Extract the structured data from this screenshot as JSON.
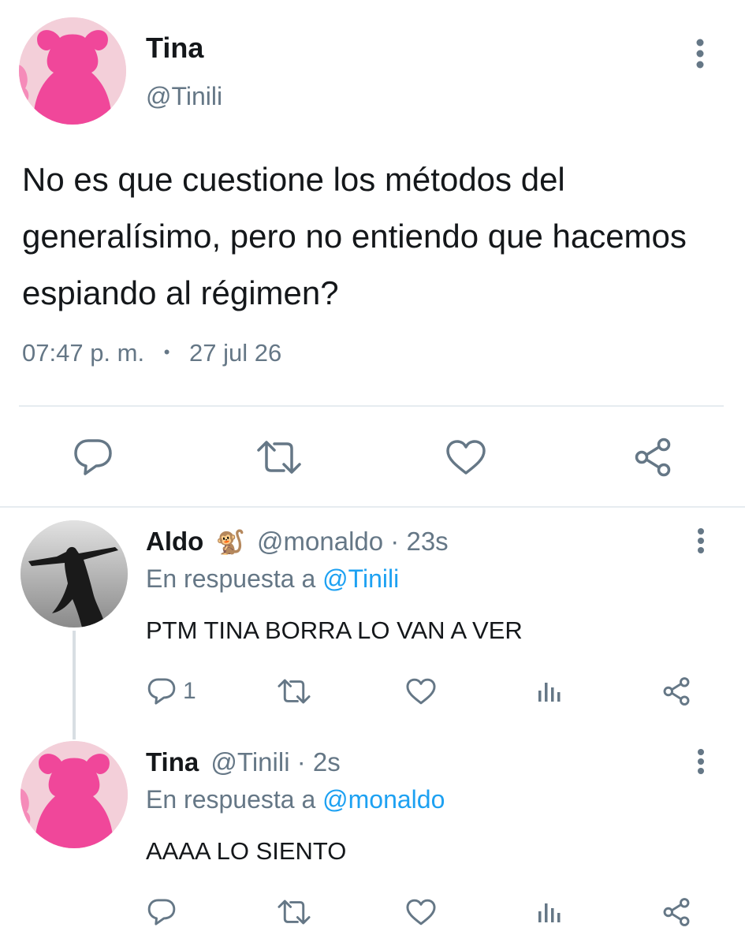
{
  "main_tweet": {
    "name": "Tina",
    "handle": "@Tinili",
    "text": "No es que cuestione los métodos del generalísimo, pero no entiendo que hacemos espiando al régimen?",
    "time": "07:47 p. m.",
    "separator": "•",
    "date": "27 jul 26"
  },
  "replies": [
    {
      "name": "Aldo",
      "emoji": "🐒",
      "handle": "@monaldo",
      "dot": "·",
      "time": "23s",
      "reply_prefix": "En respuesta a",
      "reply_to": "@Tinili",
      "text": "PTM TINA BORRA LO VAN A VER",
      "reply_count": "1"
    },
    {
      "name": "Tina",
      "handle": "@Tinili",
      "dot": "·",
      "time": "2s",
      "reply_prefix": "En respuesta a",
      "reply_to": "@monaldo",
      "text": "AAAA LO SIENTO"
    }
  ],
  "colors": {
    "accent": "#1da1f2",
    "icon_gray": "#657786",
    "avatar_pink": "#f0479a",
    "avatar_bg": "#f3cfd9"
  },
  "icons": [
    "more-icon",
    "reply-icon",
    "retweet-icon",
    "like-icon",
    "share-icon",
    "analytics-icon"
  ]
}
